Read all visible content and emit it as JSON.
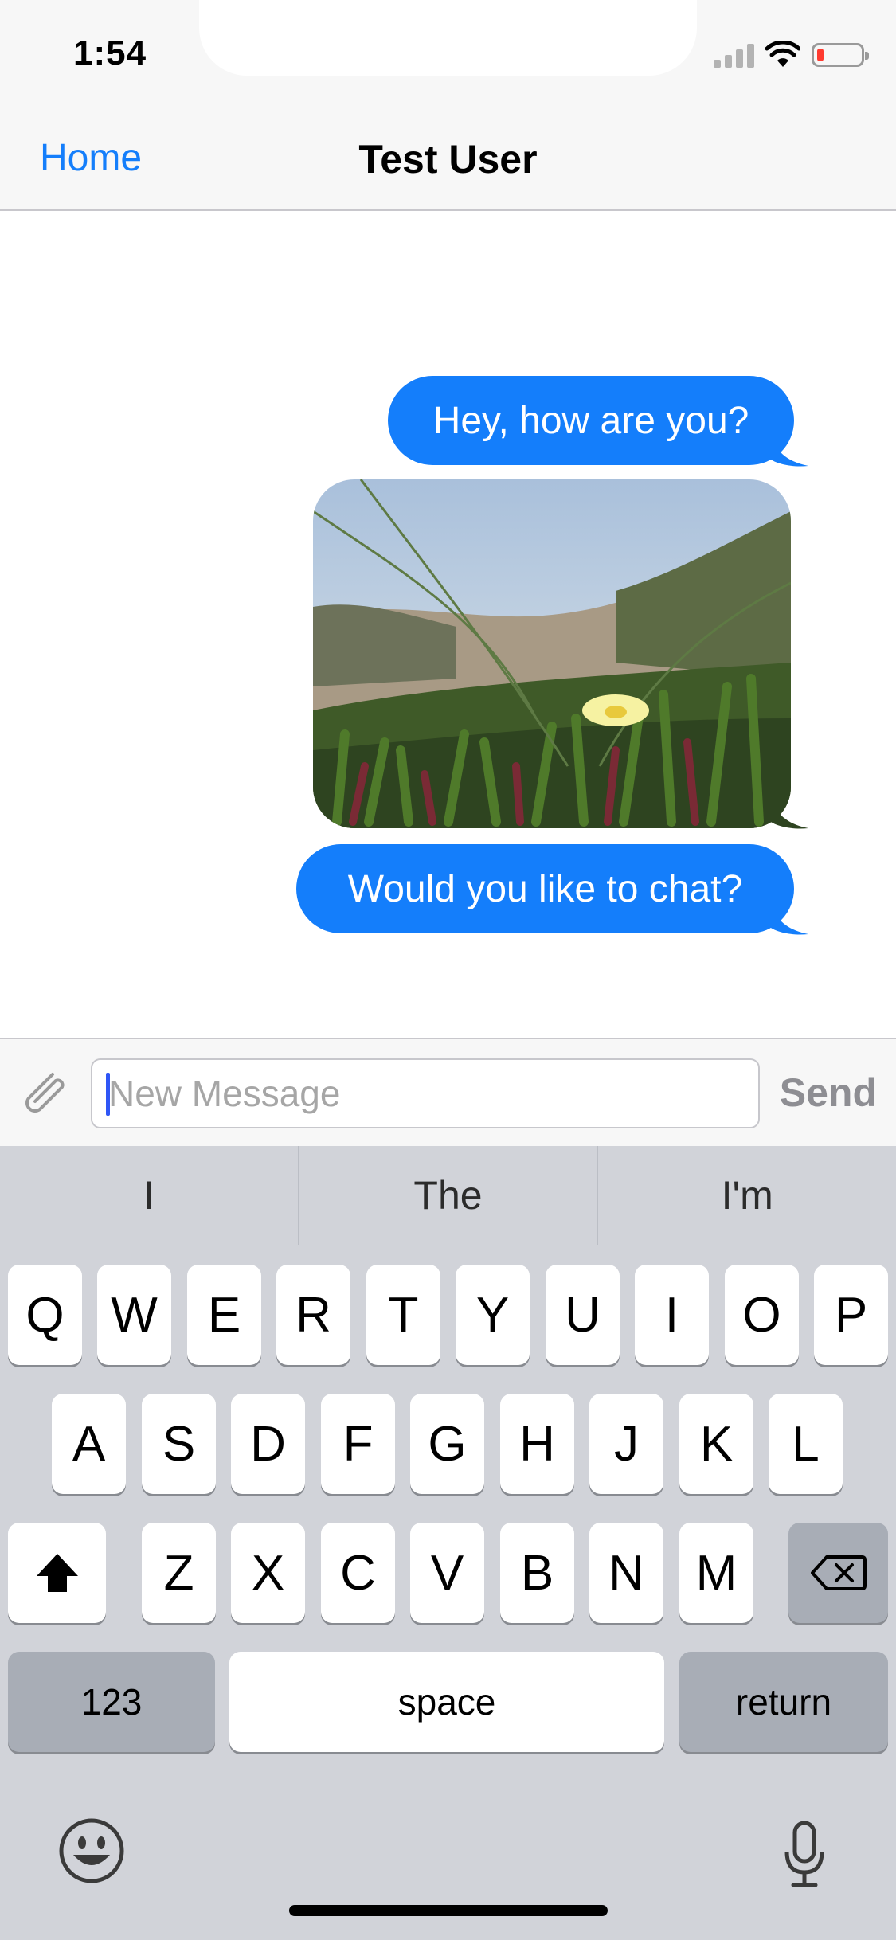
{
  "status_bar": {
    "time": "1:54",
    "icons": [
      "cellular-signal-icon",
      "wifi-icon",
      "battery-low-icon"
    ],
    "battery_color": "#ff3b30",
    "battery_level": 0.15
  },
  "nav": {
    "back_label": "Home",
    "title": "Test User"
  },
  "conversation": {
    "accent_color": "#147efb",
    "messages": [
      {
        "type": "text",
        "text": "Hey, how are you?"
      },
      {
        "type": "image",
        "description_icon": "photo-icon"
      },
      {
        "type": "text",
        "text": "Would you like to chat?"
      }
    ]
  },
  "composer": {
    "attach_icon": "paperclip-icon",
    "placeholder": "New Message",
    "value": "",
    "send_label": "Send"
  },
  "keyboard": {
    "suggestions": [
      "I",
      "The",
      "I'm"
    ],
    "row1": [
      "Q",
      "W",
      "E",
      "R",
      "T",
      "Y",
      "U",
      "I",
      "O",
      "P"
    ],
    "row2": [
      "A",
      "S",
      "D",
      "F",
      "G",
      "H",
      "J",
      "K",
      "L"
    ],
    "row3": [
      "Z",
      "X",
      "C",
      "V",
      "B",
      "N",
      "M"
    ],
    "shift_icon": "shift-icon",
    "delete_icon": "delete-backward-icon",
    "numbers_label": "123",
    "space_label": "space",
    "return_label": "return",
    "emoji_icon": "emoji-icon",
    "mic_icon": "microphone-icon"
  }
}
